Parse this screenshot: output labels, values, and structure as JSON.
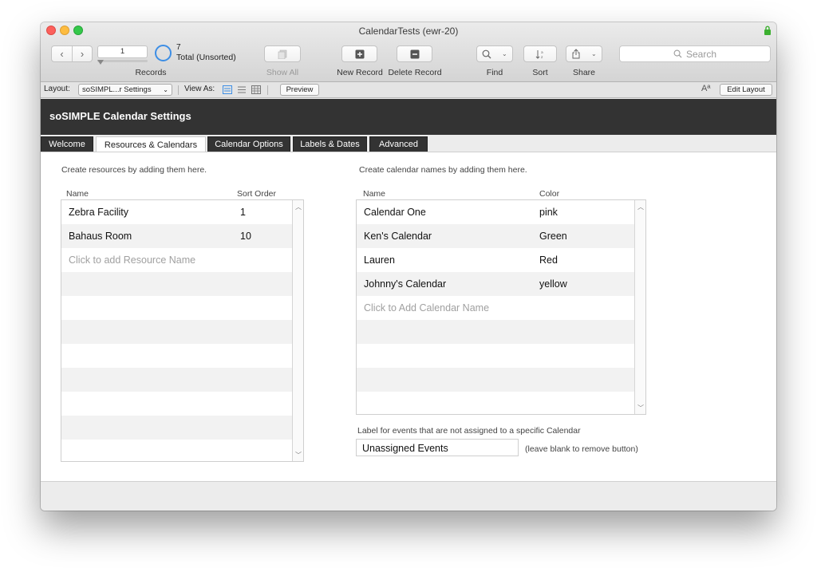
{
  "window": {
    "title": "CalendarTests (ewr-20)"
  },
  "toolbar": {
    "record_number": "1",
    "total_count": "7",
    "total_label": "Total (Unsorted)",
    "records_label": "Records",
    "show_all_label": "Show All",
    "new_record_label": "New Record",
    "delete_record_label": "Delete Record",
    "find_label": "Find",
    "sort_label": "Sort",
    "share_label": "Share",
    "search_placeholder": "Search"
  },
  "layout_bar": {
    "layout_label": "Layout:",
    "layout_value": "soSIMPL...r Settings",
    "view_as_label": "View As:",
    "preview_label": "Preview",
    "font_size_glyph": "Aª",
    "edit_layout_label": "Edit Layout"
  },
  "header": {
    "title": "soSIMPLE Calendar Settings"
  },
  "tabs": [
    {
      "label": "Welcome",
      "active": false
    },
    {
      "label": "Resources & Calendars",
      "active": true
    },
    {
      "label": "Calendar Options",
      "active": false
    },
    {
      "label": "Labels & Dates",
      "active": false
    },
    {
      "label": "Advanced",
      "active": false
    }
  ],
  "resources": {
    "hint": "Create resources by adding them here.",
    "col_name": "Name",
    "col_sort": "Sort Order",
    "rows": [
      {
        "name": "Zebra Facility",
        "sort": "1"
      },
      {
        "name": "Bahaus Room",
        "sort": "10"
      }
    ],
    "add_placeholder": "Click to add Resource Name"
  },
  "calendars": {
    "hint": "Create calendar names by adding them here.",
    "col_name": "Name",
    "col_color": "Color",
    "rows": [
      {
        "name": "Calendar One",
        "color": "pink"
      },
      {
        "name": "Ken's Calendar",
        "color": "Green"
      },
      {
        "name": "Lauren",
        "color": "Red"
      },
      {
        "name": "Johnny's Calendar",
        "color": "yellow"
      }
    ],
    "add_placeholder": "Click to Add Calendar Name"
  },
  "unassigned": {
    "label": "Label for events that are not assigned to a specific Calendar",
    "value": "Unassigned Events",
    "note": "(leave blank to remove button)"
  },
  "colors": {
    "header_bg": "#333333",
    "accent_blue": "#3d8ee5",
    "lock_green": "#3cb030"
  }
}
